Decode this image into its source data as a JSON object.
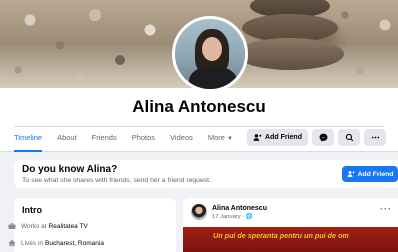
{
  "profile": {
    "name": "Alina Antonescu"
  },
  "tabs": [
    {
      "label": "Timeline",
      "active": true
    },
    {
      "label": "About"
    },
    {
      "label": "Friends"
    },
    {
      "label": "Photos"
    },
    {
      "label": "Videos"
    },
    {
      "label": "More"
    }
  ],
  "actions": {
    "add_friend": "Add Friend"
  },
  "know": {
    "title": "Do you know Alina?",
    "subtitle": "To see what she shares with friends, send her a friend request.",
    "button": "Add Friend"
  },
  "intro": {
    "title": "Intro",
    "work_prefix": "Works at",
    "work_place": "Realitatea TV",
    "lives_prefix": "Lives in",
    "lives_place": "Bucharest, Romania"
  },
  "post": {
    "author": "Alina Antonescu",
    "date": "17 January · ",
    "more": "···",
    "image_text": "Un pui de speranta pentru un pui de om"
  },
  "colors": {
    "accent": "#1877f2",
    "background": "#f0f2f5"
  }
}
